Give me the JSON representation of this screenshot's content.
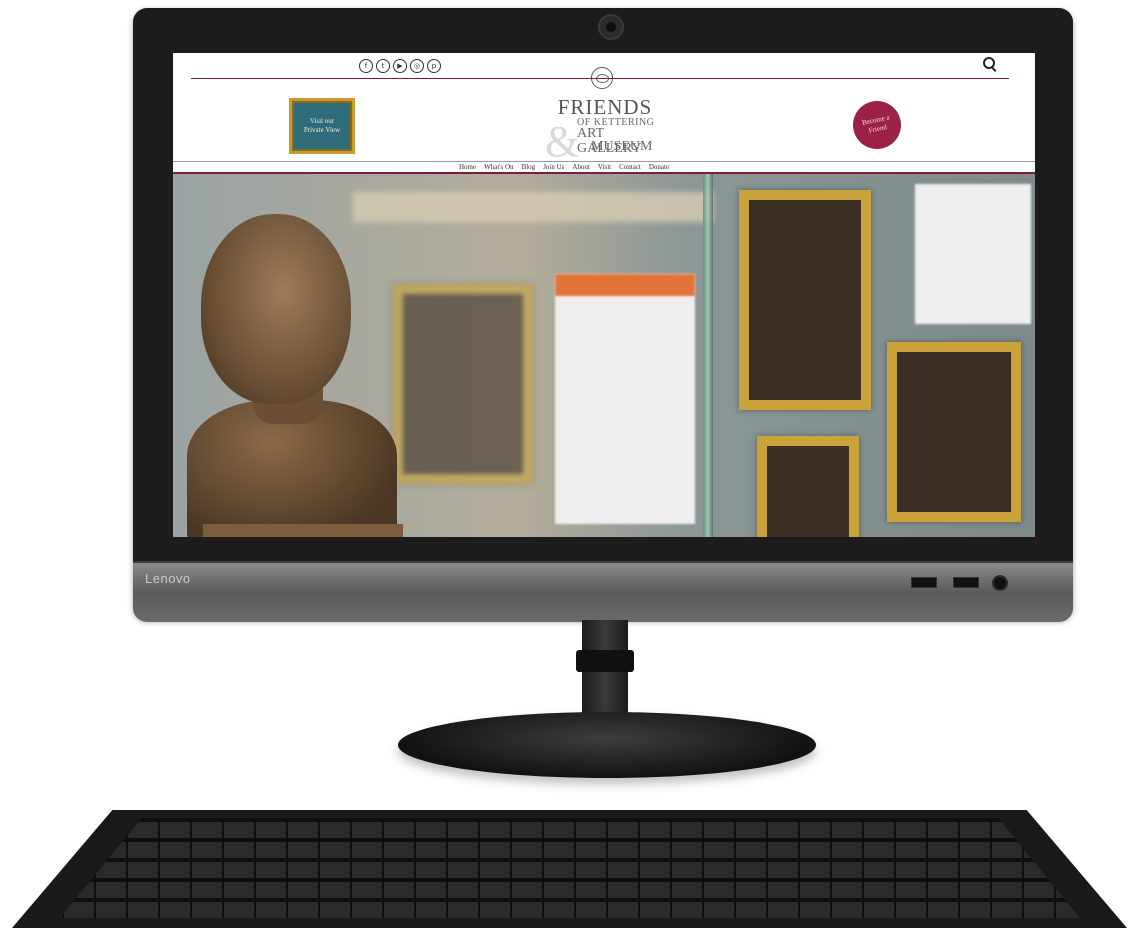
{
  "device": {
    "brand": "Lenovo"
  },
  "site": {
    "social_icons": [
      "facebook-icon",
      "twitter-icon",
      "youtube-icon",
      "instagram-icon",
      "pinterest-icon"
    ],
    "private_view": {
      "label": "Visit our\nPrivate View"
    },
    "logo": {
      "line1": "FRIENDS",
      "line2": "OF KETTERING",
      "line3": "ART GALLERY",
      "line4": "MUSEUM",
      "ampersand": "&"
    },
    "become_friend": {
      "label": "Become a\nFriend"
    },
    "nav": [
      "Home",
      "What's On",
      "Blog",
      "Join Us",
      "About",
      "Visit",
      "Contact",
      "Donate"
    ],
    "colors": {
      "accent": "#7a1d3c",
      "badge": "#9c2146",
      "panel": "#2f6c7b",
      "gold": "#c99a2e"
    }
  }
}
